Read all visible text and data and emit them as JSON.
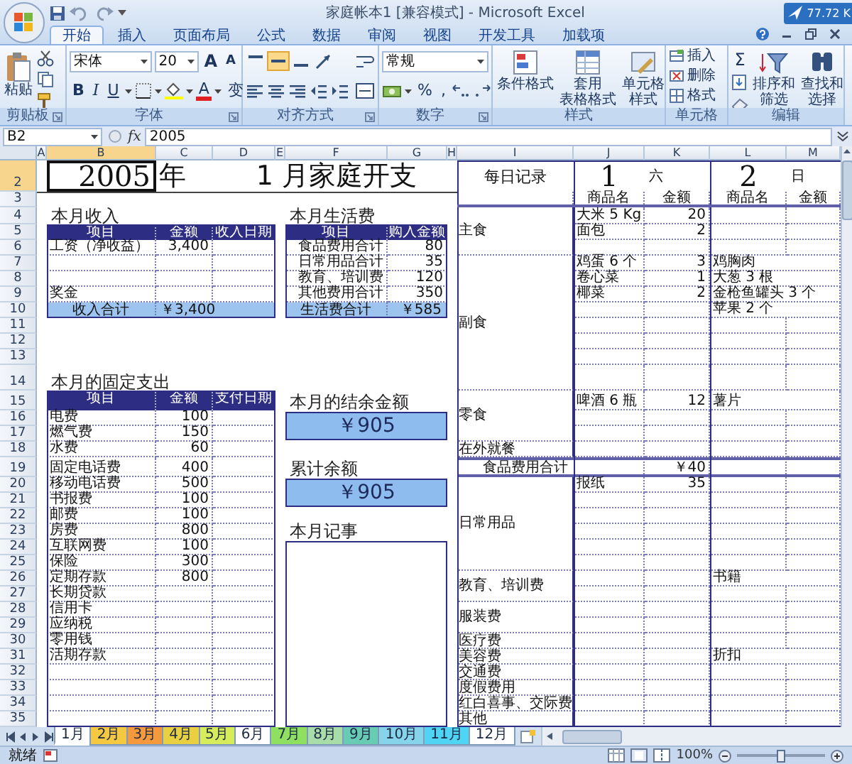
{
  "window": {
    "title": "家庭帐本1  [兼容模式] - Microsoft Excel",
    "widget": "77.72 K"
  },
  "ribbon_tabs": [
    {
      "label": "开始",
      "selected": true
    },
    {
      "label": "插入",
      "selected": false
    },
    {
      "label": "页面布局",
      "selected": false
    },
    {
      "label": "公式",
      "selected": false
    },
    {
      "label": "数据",
      "selected": false
    },
    {
      "label": "审阅",
      "selected": false
    },
    {
      "label": "视图",
      "selected": false
    },
    {
      "label": "开发工具",
      "selected": false
    },
    {
      "label": "加载项",
      "selected": false
    }
  ],
  "ribbon": {
    "clipboard": {
      "paste": "粘贴",
      "label": "剪贴板"
    },
    "font": {
      "name": "宋体",
      "size": "20",
      "grow": "A",
      "shrink": "A",
      "bold": "B",
      "italic": "I",
      "underline": "U",
      "font_color": "A",
      "phonetic": "变",
      "label": "字体"
    },
    "alignment": {
      "vertical": [
        {
          "selected": false
        },
        {
          "selected": true
        },
        {
          "selected": false
        }
      ],
      "label": "对齐方式"
    },
    "number": {
      "format": "常规",
      "percent": "%",
      "comma": ",",
      "label": "数字"
    },
    "styles": {
      "buttons": [
        {
          "lines": [
            "条件格式"
          ]
        },
        {
          "lines": [
            "套用",
            "表格格式"
          ]
        },
        {
          "lines": [
            "单元格",
            "样式"
          ]
        }
      ],
      "label": "样式"
    },
    "cells": {
      "buttons": [
        "插入",
        "删除",
        "格式"
      ],
      "label": "单元格"
    },
    "editing": {
      "sum": "Σ",
      "buttons": [
        {
          "lines": [
            "排序和",
            "筛选"
          ]
        },
        {
          "lines": [
            "查找和",
            "选择"
          ]
        }
      ],
      "label": "编辑"
    }
  },
  "formula_bar": {
    "name_box": "B2",
    "fx": "fx",
    "formula": "2005"
  },
  "columns": [
    {
      "label": "A",
      "selected": false
    },
    {
      "label": "B",
      "selected": true
    },
    {
      "label": "C",
      "selected": false
    },
    {
      "label": "D",
      "selected": false
    },
    {
      "label": "E",
      "selected": false
    },
    {
      "label": "F",
      "selected": false
    },
    {
      "label": "G",
      "selected": false
    },
    {
      "label": "H",
      "selected": false
    },
    {
      "label": "I",
      "selected": false
    },
    {
      "label": "J",
      "selected": false
    },
    {
      "label": "K",
      "selected": false
    },
    {
      "label": "L",
      "selected": false
    },
    {
      "label": "M",
      "selected": false
    }
  ],
  "rows": [
    {
      "label": "2",
      "selected": true
    },
    {
      "label": "3",
      "selected": false
    },
    {
      "label": "4",
      "selected": false
    },
    {
      "label": "5",
      "selected": false
    },
    {
      "label": "6",
      "selected": false
    },
    {
      "label": "7",
      "selected": false
    },
    {
      "label": "8",
      "selected": false
    },
    {
      "label": "9",
      "selected": false
    },
    {
      "label": "10",
      "selected": false
    },
    {
      "label": "11",
      "selected": false
    },
    {
      "label": "12",
      "selected": false
    },
    {
      "label": "13",
      "selected": false
    },
    {
      "label": "14",
      "selected": false
    },
    {
      "label": "15",
      "selected": false
    },
    {
      "label": "16",
      "selected": false
    },
    {
      "label": "17",
      "selected": false
    },
    {
      "label": "18",
      "selected": false
    },
    {
      "label": "19",
      "selected": false
    },
    {
      "label": "20",
      "selected": false
    },
    {
      "label": "21",
      "selected": false
    },
    {
      "label": "22",
      "selected": false
    },
    {
      "label": "23",
      "selected": false
    },
    {
      "label": "24",
      "selected": false
    },
    {
      "label": "25",
      "selected": false
    },
    {
      "label": "26",
      "selected": false
    },
    {
      "label": "27",
      "selected": false
    },
    {
      "label": "28",
      "selected": false
    },
    {
      "label": "29",
      "selected": false
    },
    {
      "label": "30",
      "selected": false
    },
    {
      "label": "31",
      "selected": false
    },
    {
      "label": "32",
      "selected": false
    },
    {
      "label": "33",
      "selected": false
    },
    {
      "label": "34",
      "selected": false
    },
    {
      "label": "35",
      "selected": false
    }
  ],
  "sheet": {
    "heading": {
      "year": {
        "text": "2005",
        "selected": true
      },
      "year_unit": "年",
      "title": "1 月家庭开支"
    },
    "income": {
      "title": "本月收入",
      "columns": [
        "项目",
        "金额",
        "收入日期"
      ],
      "rows": [
        {
          "kind": "entry",
          "item": "工资（净收益）",
          "amount": "3,400"
        },
        {
          "kind": "blank"
        },
        {
          "kind": "blank"
        },
        {
          "kind": "entry",
          "item": "奖金"
        }
      ],
      "total": {
        "label": "收入合计",
        "amount": "￥3,400"
      }
    },
    "living": {
      "title": "本月生活费",
      "columns": [
        "项目",
        "购入金额"
      ],
      "rows": [
        {
          "kind": "entry",
          "item": "食品费用合计",
          "amount": "80"
        },
        {
          "kind": "entry",
          "item": "日常用品合计",
          "amount": "35"
        },
        {
          "kind": "entry",
          "item": "教育、培训费",
          "amount": "120"
        },
        {
          "kind": "entry",
          "item": "其他费用合计",
          "amount": "350"
        }
      ],
      "total": {
        "label": "生活费合计",
        "amount": "￥585"
      }
    },
    "fixed": {
      "title": "本月的固定支出",
      "columns": [
        "项目",
        "金额",
        "支付日期"
      ],
      "rows": [
        {
          "kind": "entry",
          "item": "电费",
          "amount": "100"
        },
        {
          "kind": "entry",
          "item": "燃气费",
          "amount": "150"
        },
        {
          "kind": "entry",
          "item": "水费",
          "amount": "60"
        },
        {
          "kind": "entry",
          "item": "固定电话费",
          "amount": "400"
        },
        {
          "kind": "entry",
          "item": "移动电话费",
          "amount": "500"
        },
        {
          "kind": "entry",
          "item": "书报费",
          "amount": "100"
        },
        {
          "kind": "entry",
          "item": "邮费",
          "amount": "100"
        },
        {
          "kind": "entry",
          "item": "房费",
          "amount": "800"
        },
        {
          "kind": "entry",
          "item": "互联网费",
          "amount": "100"
        },
        {
          "kind": "entry",
          "item": "保险",
          "amount": "300"
        },
        {
          "kind": "entry",
          "item": "定期存款",
          "amount": "800"
        },
        {
          "kind": "entry",
          "item": "长期贷款"
        },
        {
          "kind": "entry",
          "item": "信用卡"
        },
        {
          "kind": "entry",
          "item": "应纳税"
        },
        {
          "kind": "entry",
          "item": "零用钱"
        },
        {
          "kind": "entry",
          "item": "活期存款"
        },
        {
          "kind": "blank"
        },
        {
          "kind": "blank"
        },
        {
          "kind": "blank"
        },
        {
          "kind": "blank"
        }
      ]
    },
    "balance": {
      "title": "本月的结余金额",
      "value": "￥905"
    },
    "cumulative": {
      "title": "累计余额",
      "value": "￥905"
    },
    "memo": {
      "title": "本月记事"
    },
    "daily": {
      "title": "每日记录",
      "days": [
        {
          "day": "1",
          "weekday": "六"
        },
        {
          "day": "2",
          "weekday": "日"
        }
      ],
      "columns": [
        "商品名",
        "金额",
        "商品名",
        "金额"
      ],
      "categories": [
        {
          "kind": "group",
          "label": "主食",
          "rows": [
            {
              "kind": "entry",
              "item1": "大米 5 Kg",
              "amount1": "20"
            },
            {
              "kind": "entry",
              "item1": "面包",
              "amount1": "2"
            },
            {
              "kind": "blank"
            }
          ]
        },
        {
          "kind": "group",
          "label": "副食",
          "rows": [
            {
              "kind": "entry",
              "item1": "鸡蛋 6 个",
              "amount1": "3",
              "item2": "鸡胸肉"
            },
            {
              "kind": "entry",
              "item1": "卷心菜",
              "amount1": "1",
              "item2": "大葱 3 根"
            },
            {
              "kind": "entry",
              "item1": "椰菜",
              "amount1": "2",
              "item2": "金枪鱼罐头 3 个"
            },
            {
              "kind": "entry",
              "item2": "苹果 2 个"
            },
            {
              "kind": "blank"
            },
            {
              "kind": "blank"
            },
            {
              "kind": "blank"
            },
            {
              "kind": "blank"
            }
          ]
        },
        {
          "kind": "group",
          "label": "零食",
          "rows": [
            {
              "kind": "entry",
              "item1": "啤酒 6 瓶",
              "amount1": "12",
              "item2": "薯片"
            },
            {
              "kind": "blank"
            },
            {
              "kind": "blank"
            }
          ]
        },
        {
          "kind": "group",
          "label": "在外就餐",
          "rows": [
            {
              "kind": "blank"
            }
          ]
        },
        {
          "kind": "total",
          "label": "食品费用合计",
          "amount": "￥40"
        },
        {
          "kind": "group",
          "label": "日常用品",
          "rows": [
            {
              "kind": "entry",
              "item1": "报纸",
              "amount1": "35"
            },
            {
              "kind": "blank"
            },
            {
              "kind": "blank"
            },
            {
              "kind": "blank"
            },
            {
              "kind": "blank"
            },
            {
              "kind": "blank"
            }
          ]
        },
        {
          "kind": "group",
          "label": "教育、培训费",
          "rows": [
            {
              "kind": "entry",
              "item2": "书籍"
            },
            {
              "kind": "blank"
            }
          ]
        },
        {
          "kind": "group",
          "label": "服装费",
          "rows": [
            {
              "kind": "blank"
            },
            {
              "kind": "blank"
            }
          ]
        },
        {
          "kind": "group",
          "label": "医疗费",
          "rows": [
            {
              "kind": "blank"
            }
          ]
        },
        {
          "kind": "group",
          "label": "美容费",
          "rows": [
            {
              "kind": "entry",
              "item2": "折扣"
            }
          ]
        },
        {
          "kind": "group",
          "label": "交通费",
          "rows": [
            {
              "kind": "blank"
            }
          ]
        },
        {
          "kind": "group",
          "label": "度假费用",
          "rows": [
            {
              "kind": "blank"
            }
          ]
        },
        {
          "kind": "group",
          "label": "红白喜事、交际费",
          "rows": [
            {
              "kind": "blank"
            }
          ]
        },
        {
          "kind": "group",
          "label": "其他",
          "rows": [
            {
              "kind": "blank"
            }
          ]
        }
      ]
    }
  },
  "sheet_tabs": [
    {
      "label": "1月",
      "selected": true,
      "color": "#ffffff"
    },
    {
      "label": "2月",
      "selected": false,
      "color": "#f5c842"
    },
    {
      "label": "3月",
      "selected": false,
      "color": "#f59a3c"
    },
    {
      "label": "4月",
      "selected": false,
      "color": "#e8d040"
    },
    {
      "label": "5月",
      "selected": false,
      "color": "#d6ec5a"
    },
    {
      "label": "6月",
      "selected": false,
      "color": "#ffffff"
    },
    {
      "label": "7月",
      "selected": false,
      "color": "#8fe060"
    },
    {
      "label": "8月",
      "selected": false,
      "color": "#a8dca8"
    },
    {
      "label": "9月",
      "selected": false,
      "color": "#68ccb4"
    },
    {
      "label": "10月",
      "selected": false,
      "color": "#86d4ea"
    },
    {
      "label": "11月",
      "selected": false,
      "color": "#4fd4f4"
    },
    {
      "label": "12月",
      "selected": false,
      "color": "#ffffff"
    }
  ],
  "status_bar": {
    "text": "就绪",
    "zoom": {
      "text": "100%",
      "level": 0.5
    }
  }
}
